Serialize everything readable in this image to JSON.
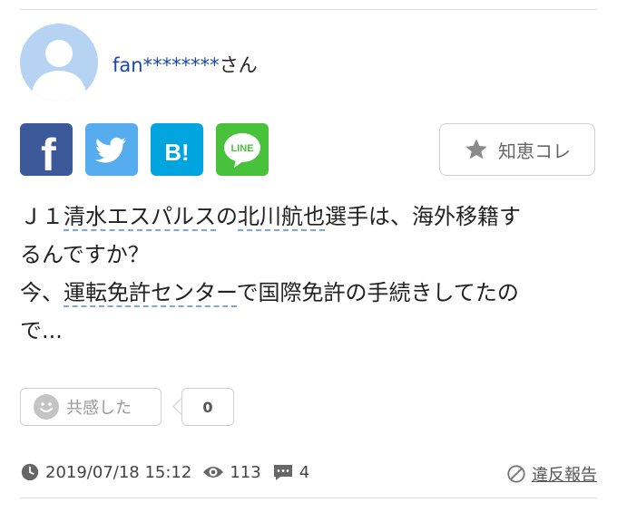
{
  "user": {
    "name": "fan********",
    "suffix": "さん"
  },
  "share": {
    "facebook_glyph": "f",
    "hatena_label": "B!",
    "line_label": "LINE"
  },
  "chie_button": {
    "label": "知恵コレ",
    "icon": "star-icon"
  },
  "question": {
    "line1_prefix": "Ｊ１",
    "kw1": "清水エスパルス",
    "line1_mid": "の",
    "kw2": "北川航也",
    "line1_suffix": "選手は、海外移籍す",
    "line2": "るんですか？",
    "line3_prefix": "今、",
    "kw3": "運転免許センター",
    "line3_suffix": "で国際免許の手続きしてたの",
    "line4": "で..."
  },
  "empathy": {
    "label": "共感した",
    "count": "0"
  },
  "meta": {
    "datetime": "2019/07/18 15:12",
    "views": "113",
    "answers": "4"
  },
  "report": {
    "label": "違反報告"
  },
  "colors": {
    "facebook": "#3b5998",
    "twitter": "#55acee",
    "hatena": "#00a4de",
    "line": "#48c23a",
    "username": "#1a47a8"
  }
}
